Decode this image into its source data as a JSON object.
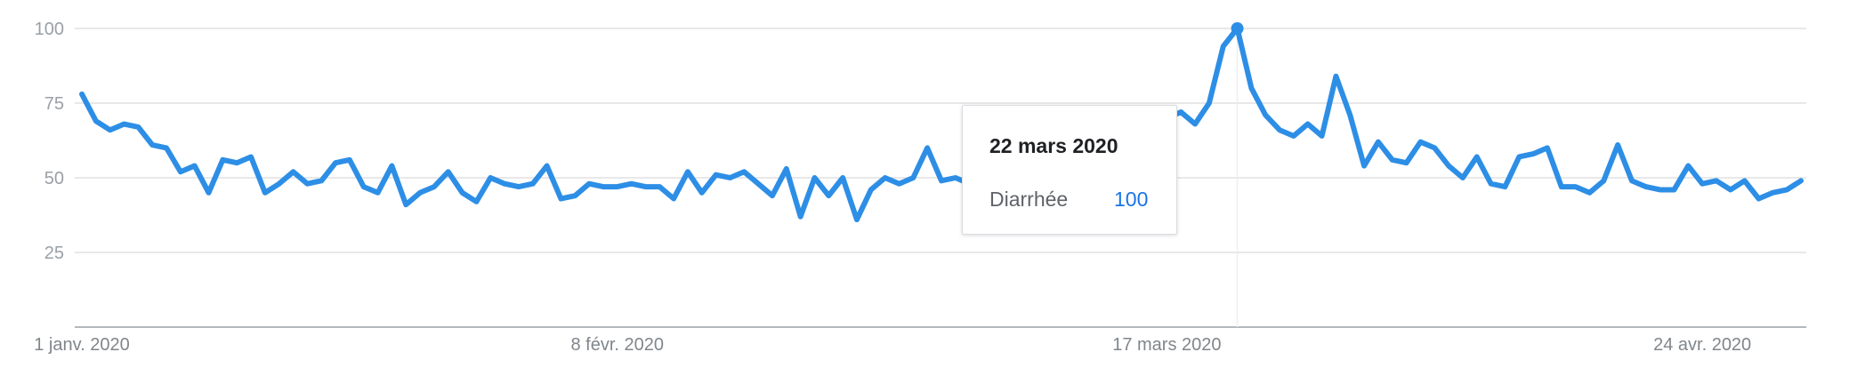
{
  "chart_data": {
    "type": "line",
    "title": "",
    "xlabel": "",
    "ylabel": "",
    "ylim": [
      0,
      100
    ],
    "y_ticks": [
      25,
      50,
      75,
      100
    ],
    "y_tick_labels": [
      "25",
      "50",
      "75",
      "100"
    ],
    "x_tick_labels": [
      "1 janv. 2020",
      "8 févr. 2020",
      "17 mars 2020",
      "24 avr. 2020"
    ],
    "x_tick_indices": [
      0,
      38,
      77,
      115
    ],
    "grid": true,
    "line_color": "#2d8ee6",
    "grid_color": "#e0e0e0",
    "axis_color": "#9aa0a6",
    "series": [
      {
        "name": "Diarrhée",
        "values": [
          78,
          69,
          66,
          68,
          67,
          61,
          60,
          52,
          54,
          45,
          56,
          55,
          57,
          45,
          48,
          52,
          48,
          49,
          55,
          56,
          47,
          45,
          54,
          41,
          45,
          47,
          52,
          45,
          42,
          50,
          48,
          47,
          48,
          54,
          43,
          44,
          48,
          47,
          47,
          48,
          47,
          47,
          43,
          52,
          45,
          51,
          50,
          52,
          48,
          44,
          53,
          37,
          50,
          44,
          50,
          36,
          46,
          50,
          48,
          50,
          60,
          49,
          50,
          48,
          48,
          47,
          52,
          51,
          55,
          45,
          52,
          55,
          43,
          48,
          62,
          62,
          62,
          70,
          72,
          68,
          75,
          94,
          100,
          80,
          71,
          66,
          64,
          68,
          64,
          84,
          71,
          54,
          62,
          56,
          55,
          62,
          60,
          54,
          50,
          57,
          48,
          47,
          57,
          58,
          60,
          47,
          47,
          45,
          49,
          61,
          49,
          47,
          46,
          46,
          54,
          48,
          49,
          46,
          49,
          43,
          45,
          46,
          49
        ]
      }
    ],
    "highlight_index": 82,
    "tooltip": {
      "date": "22 mars 2020",
      "series": "Diarrhée",
      "value": "100"
    }
  }
}
